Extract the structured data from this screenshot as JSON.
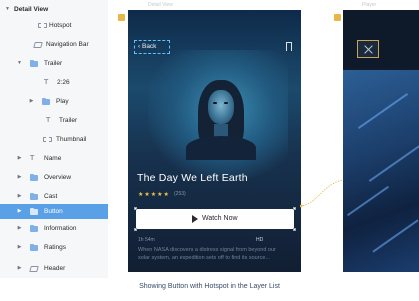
{
  "layer_list": {
    "items": [
      {
        "label": "Detail View",
        "icon": "artboard-icon"
      },
      {
        "label": "Hotspot",
        "icon": "hotspot-icon"
      },
      {
        "label": "Navigation Bar",
        "icon": "symbol-icon"
      },
      {
        "label": "Trailer",
        "icon": "folder-icon"
      },
      {
        "label": "2:26",
        "icon": "text-icon"
      },
      {
        "label": "Play",
        "icon": "folder-icon"
      },
      {
        "label": "Trailer",
        "icon": "text-icon"
      },
      {
        "label": "Thumbnail",
        "icon": "image-icon"
      },
      {
        "label": "Name",
        "icon": "text-icon"
      },
      {
        "label": "Overview",
        "icon": "folder-icon"
      },
      {
        "label": "Cast",
        "icon": "folder-icon"
      },
      {
        "label": "Button",
        "icon": "folder-icon",
        "selected": true
      },
      {
        "label": "Information",
        "icon": "folder-icon"
      },
      {
        "label": "Ratings",
        "icon": "folder-icon"
      },
      {
        "label": "Header",
        "icon": "symbol-icon"
      }
    ],
    "selected_color": "#5aa0e6"
  },
  "artboards": [
    {
      "label": "Detail View"
    },
    {
      "label": "Player"
    }
  ],
  "detail": {
    "back_label": "Back",
    "title": "The Day We Left Earth",
    "stars": "★★★★★",
    "rating_count": "(253)",
    "watch_label": "Watch Now",
    "meta_left": "1h 54m",
    "meta_right": "HD",
    "synopsis": "When NASA discovers a distress signal from beyond our solar system, an expedition sets off to find its source..."
  },
  "caption": "Showing Button with Hotspot in the Layer List",
  "colors": {
    "accent": "#e9b64a",
    "hotspot_outline": "#5ec2ff",
    "star": "#f2c44a"
  }
}
